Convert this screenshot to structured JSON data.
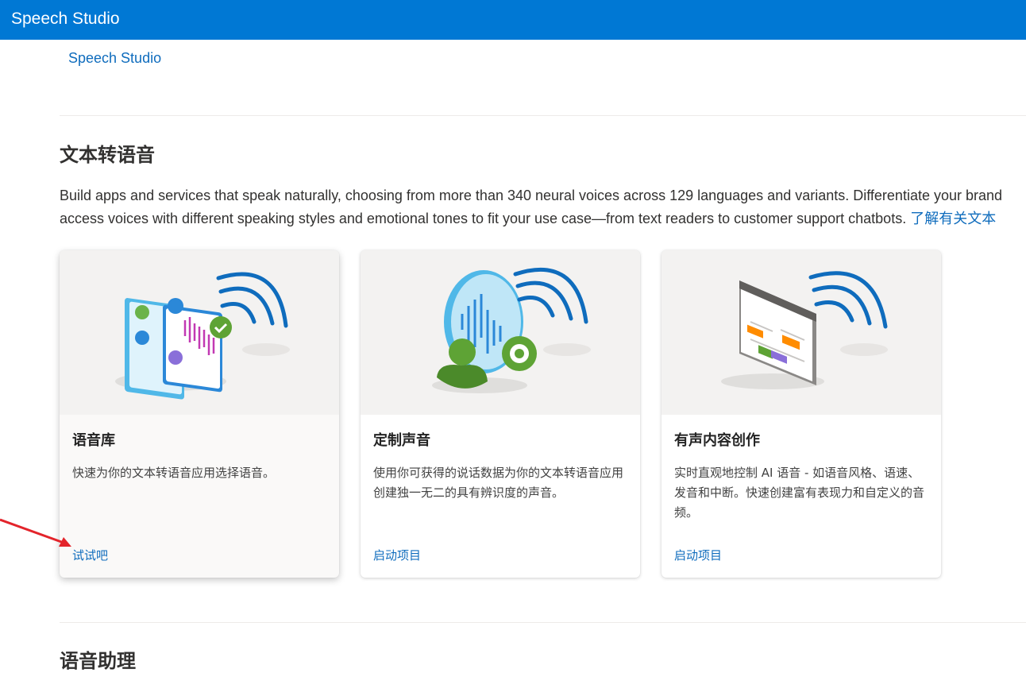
{
  "header": {
    "app_title": "Speech Studio"
  },
  "breadcrumb": {
    "label": "Speech Studio"
  },
  "sections": [
    {
      "title": "文本转语音",
      "description_line1": "Build apps and services that speak naturally, choosing from more than 340 neural voices across 129 languages and variants. Differentiate your brand",
      "description_line2": "access voices with different speaking styles and emotional tones to fit your use case—from text readers to customer support chatbots. ",
      "learn_more_label": "了解有关文本",
      "cards": [
        {
          "title": "语音库",
          "description": "快速为你的文本转语音应用选择语音。",
          "action": "试试吧",
          "icon": "voice-gallery-illustration"
        },
        {
          "title": "定制声音",
          "description": "使用你可获得的说话数据为你的文本转语音应用创建独一无二的具有辨识度的声音。",
          "action": "启动项目",
          "icon": "custom-voice-illustration"
        },
        {
          "title": "有声内容创作",
          "description": "实时直观地控制 AI 语音 - 如语音风格、语速、发音和中断。快速创建富有表现力和自定义的音频。",
          "action": "启动项目",
          "icon": "audio-content-creation-illustration"
        }
      ]
    },
    {
      "title": "语音助理"
    }
  ],
  "colors": {
    "brand": "#0078d4",
    "link": "#0f6cbd",
    "annotation_arrow": "#e3242b"
  }
}
